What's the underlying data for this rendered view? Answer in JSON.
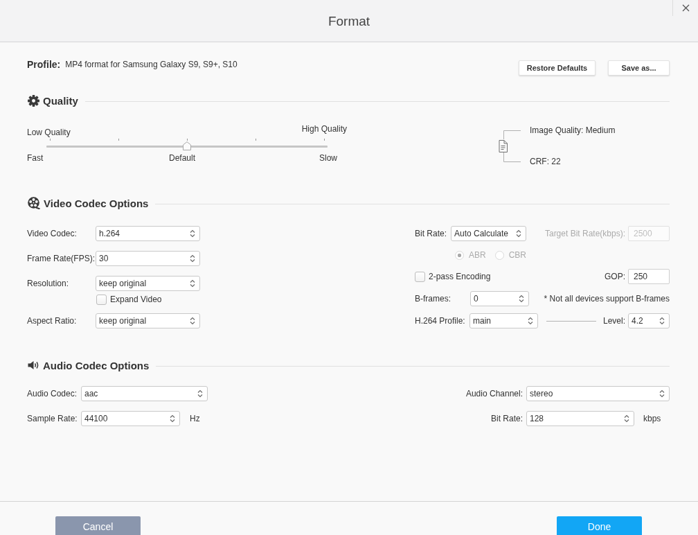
{
  "window": {
    "title": "Format"
  },
  "profile": {
    "label": "Profile:",
    "value": "MP4 format for Samsung Galaxy S9, S9+, S10"
  },
  "header_buttons": [
    "Restore Defaults",
    "Save as..."
  ],
  "quality": {
    "title": "Quality",
    "slider": {
      "top_labels": [
        "Low Quality",
        "High Quality"
      ],
      "bottom_labels": [
        "Fast",
        "Default",
        "Slow"
      ],
      "level": 0.5
    },
    "info": [
      "Image Quality: Medium",
      "CRF: 22"
    ]
  },
  "video": {
    "title": "Video Codec Options",
    "left_fields": [
      {
        "kind": "select",
        "label": "Video Codec:",
        "value": "h.264"
      },
      {
        "kind": "select",
        "label": "Frame Rate(FPS):",
        "value": "30"
      },
      {
        "kind": "select",
        "label": "Resolution:",
        "value": "keep original"
      },
      {
        "kind": "checkbox",
        "label": "Expand Video",
        "checked": false
      },
      {
        "kind": "select",
        "label": "Aspect Ratio:",
        "value": "keep original"
      }
    ],
    "bit_rate": {
      "label": "Bit Rate:",
      "value": "Auto Calculate"
    },
    "target_bit_rate": {
      "label": "Target Bit Rate(kbps):",
      "value": "2500",
      "disabled": true
    },
    "rate_modes": [
      {
        "label": "ABR",
        "selected": true,
        "disabled": true
      },
      {
        "label": "CBR",
        "selected": false,
        "disabled": true
      }
    ],
    "two_pass": {
      "label": "2-pass Encoding",
      "checked": false
    },
    "gop": {
      "label": "GOP:",
      "value": "250"
    },
    "b_frames": {
      "label": "B-frames:",
      "value": "0",
      "note": "* Not all devices support B-frames"
    },
    "h264_profile": {
      "label": "H.264 Profile:",
      "value": "main"
    },
    "h264_level": {
      "label": "Level:",
      "value": "4.2"
    }
  },
  "audio": {
    "title": "Audio Codec Options",
    "fields": [
      {
        "label": "Audio Codec:",
        "value": "aac"
      },
      {
        "label": "Audio Channel:",
        "value": "stereo"
      },
      {
        "label": "Sample Rate:",
        "value": "44100",
        "unit": "Hz"
      },
      {
        "label": "Bit Rate:",
        "value": "128",
        "unit": "kbps"
      }
    ]
  },
  "footer_buttons": [
    {
      "label": "Cancel",
      "kind": "secondary"
    },
    {
      "label": "Done",
      "kind": "primary"
    }
  ]
}
